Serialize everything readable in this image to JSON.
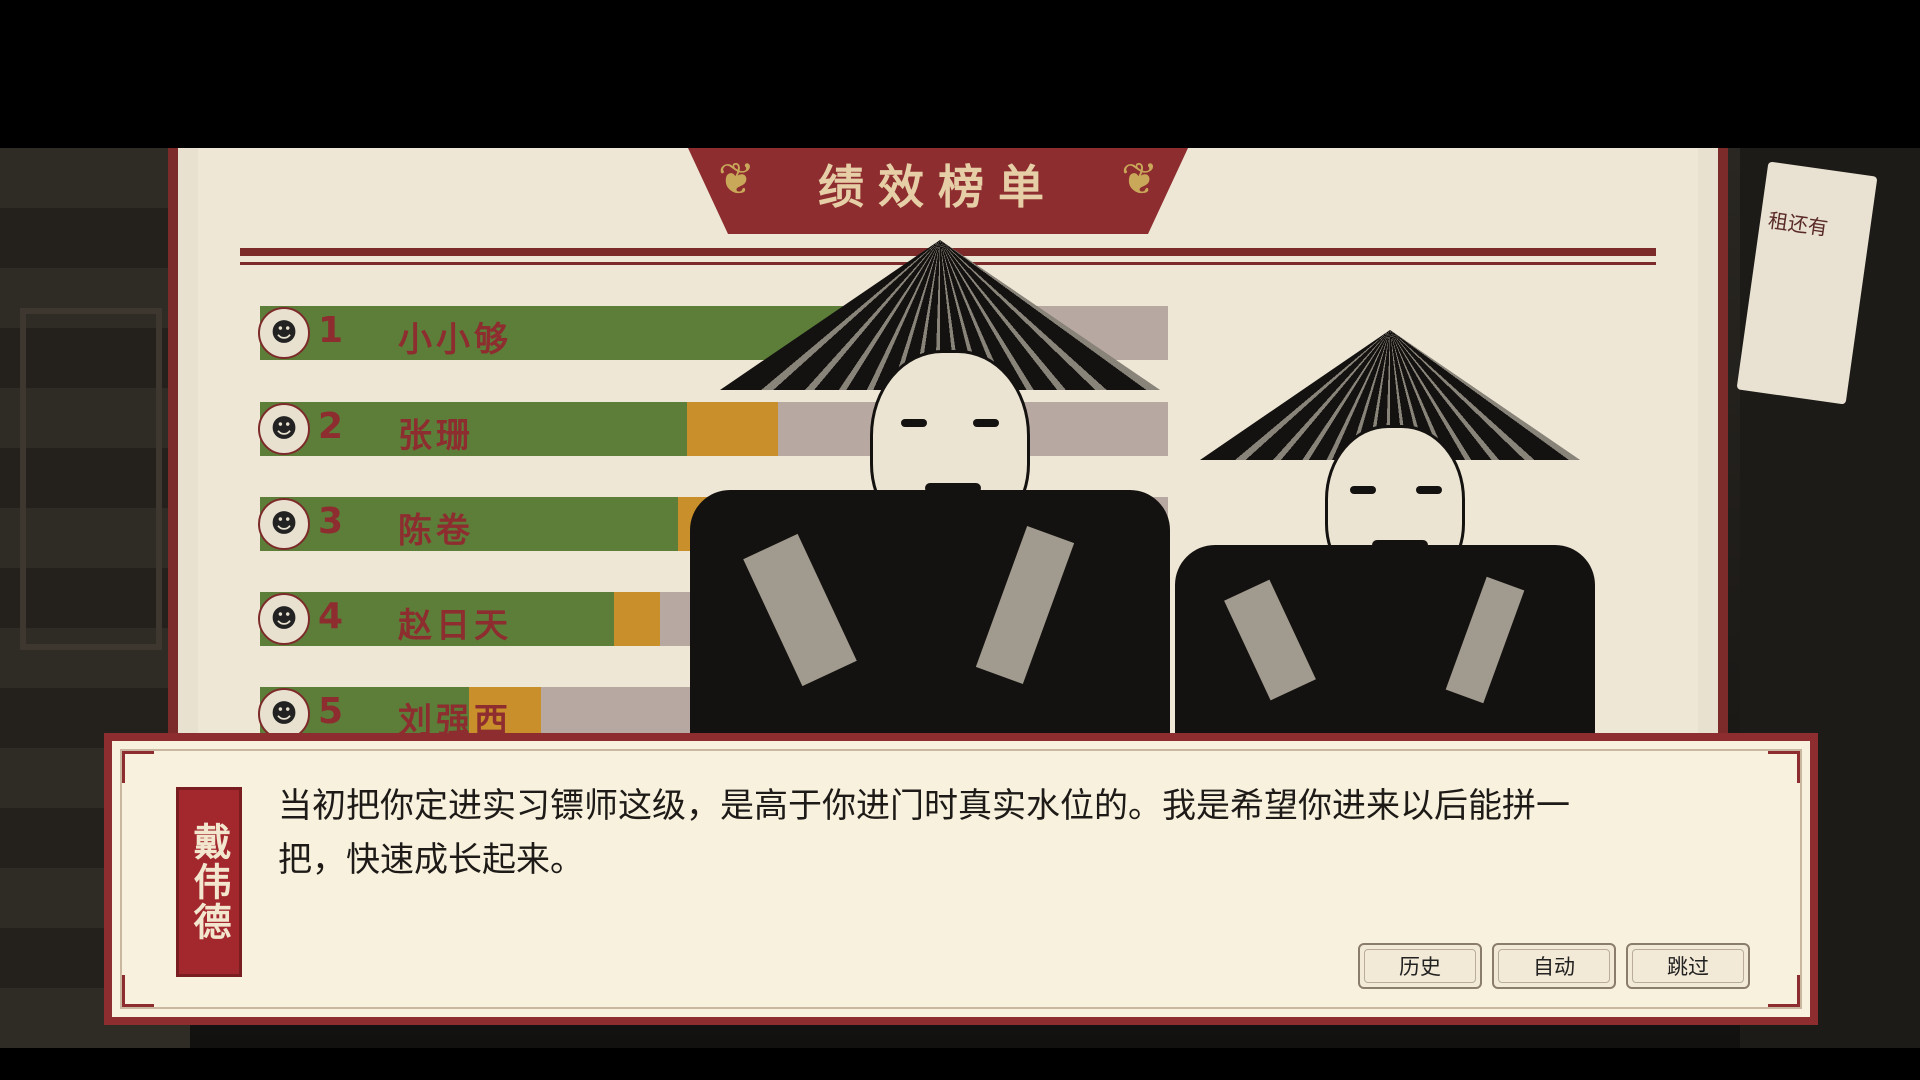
{
  "leaderboard": {
    "title": "绩效榜单",
    "entries": [
      {
        "rank": "1",
        "name": "小小够",
        "green": 0.68,
        "yellow": 0.0
      },
      {
        "rank": "2",
        "name": "张珊",
        "green": 0.47,
        "yellow": 0.1
      },
      {
        "rank": "3",
        "name": "陈卷",
        "green": 0.46,
        "yellow": 0.05
      },
      {
        "rank": "4",
        "name": "赵日天",
        "green": 0.39,
        "yellow": 0.05
      },
      {
        "rank": "5",
        "name": "刘强西",
        "green": 0.23,
        "yellow": 0.08
      }
    ]
  },
  "calendar": {
    "text": "租还有"
  },
  "dialog": {
    "speaker": "戴伟德",
    "line1": "当初把你定进实习镖师这级，是高于你进门时真实水位的。我是希望你进来以后能拼一",
    "line2": "把，快速成长起来。",
    "buttons": {
      "history": "历史",
      "auto": "自动",
      "skip": "跳过"
    }
  },
  "colors": {
    "accent": "#8e2d2f",
    "paper": "#f8f1de",
    "green": "#5c7e39",
    "yellow": "#c98f2a"
  }
}
